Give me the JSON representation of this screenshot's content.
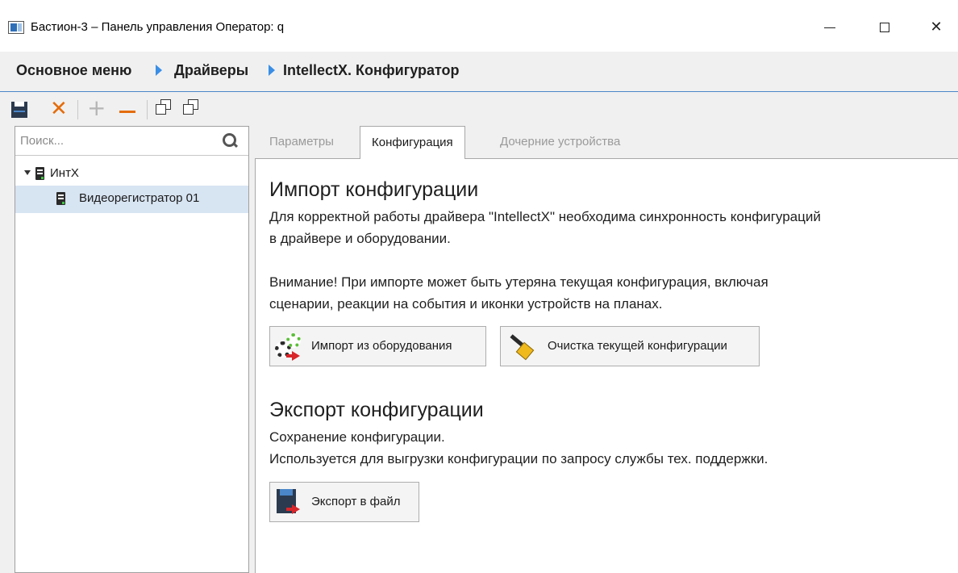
{
  "window": {
    "title": "Бастион-3 – Панель управления Оператор: q"
  },
  "breadcrumb": {
    "items": [
      "Основное меню",
      "Драйверы",
      "IntellectX. Конфигуратор"
    ]
  },
  "toolbar": {
    "icons": [
      "save-icon",
      "delete-icon",
      "add-icon",
      "remove-icon",
      "expand-all-icon",
      "collapse-all-icon"
    ]
  },
  "sidebar": {
    "search_placeholder": "Поиск...",
    "tree": [
      {
        "label": "ИнтX",
        "expanded": true,
        "level": 0
      },
      {
        "label": "Видеорегистратор 01",
        "selected": true,
        "level": 1
      }
    ]
  },
  "tabs": [
    {
      "label": "Параметры",
      "active": false
    },
    {
      "label": "Конфигурация",
      "active": true
    },
    {
      "label": "Дочерние устройства",
      "active": false
    }
  ],
  "import": {
    "title": "Импорт конфигурации",
    "desc_line1": "Для корректной работы драйвера \"IntellectX\" необходима синхронность конфигураций",
    "desc_line2": "в драйвере и оборудовании.",
    "warn_line1": "Внимание! При импорте может быть утеряна текущая конфигурация, включая",
    "warn_line2": "сценарии, реакции на события и иконки устройств на планах.",
    "btn_import": "Импорт из оборудования",
    "btn_clear": "Очистка текущей конфигурации"
  },
  "export": {
    "title": "Экспорт конфигурации",
    "desc_line1": "Сохранение конфигурации.",
    "desc_line2": "Используется для выгрузки конфигурации по запросу службы тех. поддержки.",
    "btn_export": "Экспорт в файл"
  },
  "colors": {
    "accent": "#3a8ee6",
    "orange": "#e46c0a",
    "selection": "#d7e4f2"
  }
}
